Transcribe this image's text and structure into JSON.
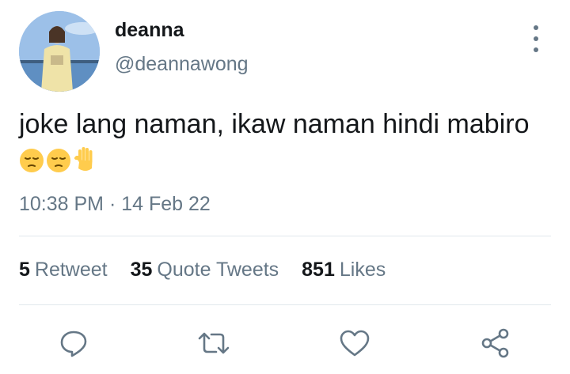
{
  "user": {
    "display_name": "deanna",
    "handle": "@deannawong"
  },
  "tweet": {
    "text": "joke lang naman, ikaw naman hindi mabiro",
    "emojis": [
      "pensive-face",
      "pensive-face",
      "raised-hand"
    ],
    "timestamp": "10:38 PM · 14 Feb 22"
  },
  "stats": {
    "retweets_count": "5",
    "retweets_label": "Retweet",
    "quote_tweets_count": "35",
    "quote_tweets_label": "Quote Tweets",
    "likes_count": "851",
    "likes_label": "Likes"
  },
  "actions": [
    "reply-icon",
    "retweet-icon",
    "like-icon",
    "share-icon"
  ],
  "colors": {
    "text": "#14171a",
    "secondary": "#657786",
    "divider": "#e1e8ed"
  }
}
